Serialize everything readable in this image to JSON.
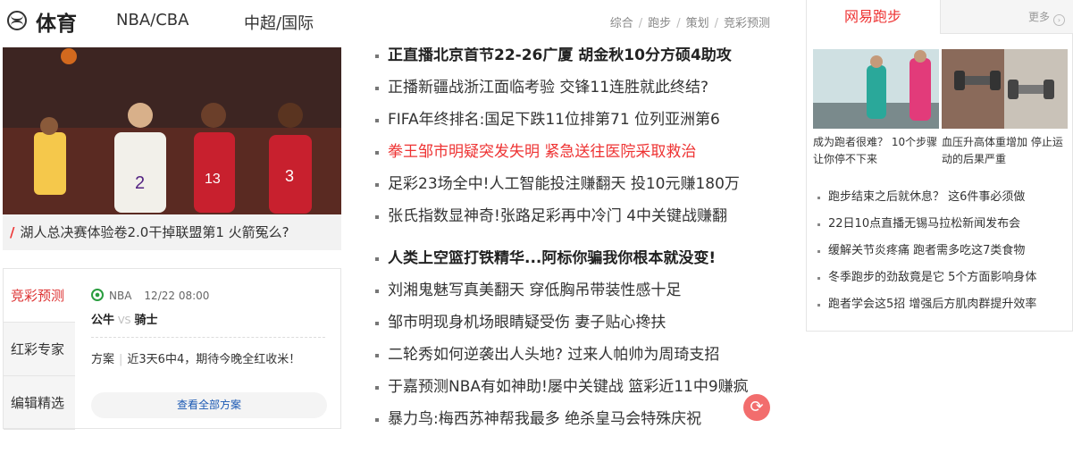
{
  "header": {
    "logo_text": "体育",
    "nav": [
      "NBA/CBA",
      "中超/国际"
    ],
    "sub_nav": [
      "综合",
      "跑步",
      "策划",
      "竞彩预测"
    ]
  },
  "hero": {
    "caption": "湖人总决赛体验卷2.0干掉联盟第1 火箭冤么?",
    "image_icon": "basketball-players-photo"
  },
  "lottery": {
    "tabs": [
      "竞彩预测",
      "红彩专家",
      "编辑精选"
    ],
    "match": {
      "league": "NBA",
      "datetime": "12/22 08:00",
      "home": "公牛",
      "vs": "VS",
      "away": "骑士"
    },
    "plan_label": "方案",
    "plan_text": "近3天6中4，期待今晚全红收米！",
    "view_all": "查看全部方案"
  },
  "news_group1": [
    {
      "text": "正直播北京首节22-26广厦 胡金秋10分方硕4助攻",
      "style": "bold"
    },
    {
      "text": "正播新疆战浙江面临考验 交锋11连胜就此终结?",
      "style": "normal"
    },
    {
      "text": "FIFA年终排名:国足下跌11位排第71 位列亚洲第6",
      "style": "normal"
    },
    {
      "text": "拳王邹市明疑突发失明 紧急送往医院采取救治",
      "style": "red"
    },
    {
      "text": "足彩23场全中!人工智能投注赚翻天 投10元赚180万",
      "style": "normal"
    },
    {
      "text": "张氏指数显神奇!张路足彩再中冷门 4中关键战赚翻",
      "style": "normal"
    }
  ],
  "news_group2": [
    {
      "text": "人类上空篮打铁精华...阿标你骗我你根本就没变!",
      "style": "bold"
    },
    {
      "text": "刘湘鬼魅写真美翻天 穿低胸吊带装性感十足",
      "style": "normal"
    },
    {
      "text": "邹市明现身机场眼睛疑受伤 妻子贴心搀扶",
      "style": "normal"
    },
    {
      "text": "二轮秀如何逆袭出人头地? 过来人帕帅为周琦支招",
      "style": "normal"
    },
    {
      "text": "于嘉预测NBA有如神助!屡中关键战 篮彩近11中9赚疯",
      "style": "normal"
    },
    {
      "text": "暴力鸟:梅西苏神帮我最多 绝杀皇马会特殊庆祝",
      "style": "normal"
    }
  ],
  "refresh_icon": "refresh-icon",
  "right": {
    "tab_title": "网易跑步",
    "more": "更多",
    "thumbs": [
      {
        "caption": "成为跑者很难？ 10个步骤让你停不下来"
      },
      {
        "caption": "血压升高体重增加 停止运动的后果严重"
      }
    ],
    "list": [
      "跑步结束之后就休息？ 这6件事必须做",
      "22日10点直播无锡马拉松新闻发布会",
      "缓解关节炎疼痛 跑者需多吃这7类食物",
      "冬季跑步的劲敌竟是它 5个方面影响身体",
      "跑者学会这5招 增强后方肌肉群提升效率"
    ]
  },
  "colors": {
    "accent_red": "#e33333",
    "link_blue": "#1a58b3"
  }
}
